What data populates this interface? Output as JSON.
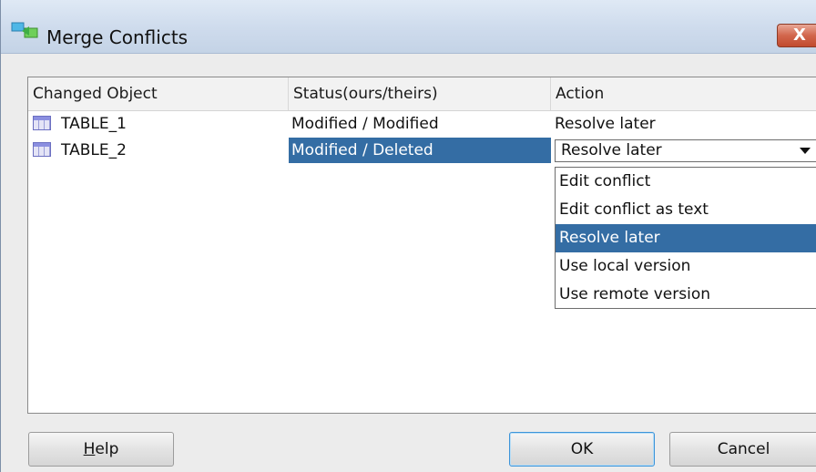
{
  "window": {
    "title": "Merge Conflicts",
    "close_glyph": "X"
  },
  "table": {
    "columns": [
      "Changed Object",
      "Status(ours/theirs)",
      "Action"
    ],
    "rows": [
      {
        "object": "TABLE_1",
        "status": "Modified / Modified",
        "action": "Resolve later",
        "selected": false
      },
      {
        "object": "TABLE_2",
        "status": "Modified / Deleted",
        "action": "Resolve later",
        "selected": true
      }
    ]
  },
  "action_combo": {
    "value": "Resolve later",
    "options": [
      "Edit conflict",
      "Edit conflict as text",
      "Resolve later",
      "Use local version",
      "Use remote version"
    ],
    "highlighted": "Resolve later"
  },
  "buttons": {
    "help": "Help",
    "ok": "OK",
    "cancel": "Cancel"
  },
  "icons": {
    "app": "merge-conflict-icon",
    "table": "table-icon",
    "combo_arrow": "chevron-down-icon"
  },
  "colors": {
    "selection": "#346da4",
    "close_button": "#d2664c",
    "ok_focus": "#3d94d9"
  }
}
